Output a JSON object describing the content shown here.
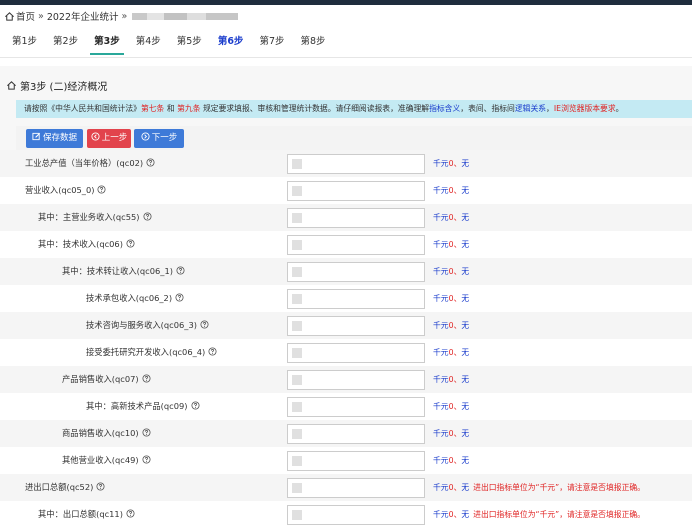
{
  "breadcrumb": {
    "home": "首页",
    "sep": "»",
    "year_item": "2022年企业统计"
  },
  "steps": [
    {
      "label": "第1步",
      "state": "normal"
    },
    {
      "label": "第2步",
      "state": "normal"
    },
    {
      "label": "第3步",
      "state": "active"
    },
    {
      "label": "第4步",
      "state": "normal"
    },
    {
      "label": "第5步",
      "state": "normal"
    },
    {
      "label": "第6步",
      "state": "blue"
    },
    {
      "label": "第7步",
      "state": "normal"
    },
    {
      "label": "第8步",
      "state": "normal"
    }
  ],
  "panel": {
    "title": "第3步 (二)经济概况"
  },
  "notice": {
    "p1": "请按照《中华人民共和国统计法》",
    "art7": "第七条",
    "and": " 和 ",
    "art9": "第九条",
    "p2": " 规定要求填报、审核和管理统计数据。请仔细阅读报表，准确理解",
    "indicator": "指标含义",
    "p3": "，表间、指标间",
    "logic": "逻辑关系",
    "p4": "，",
    "ie": "IE浏览器版本要求",
    "p5": "。"
  },
  "toolbar": {
    "save_label": "保存数据",
    "prev_label": "上一步",
    "next_label": "下一步"
  },
  "rows": [
    {
      "label": "工业总产值（当年价格）(qc02)",
      "unit": "千元",
      "value": "0",
      "sep": "、",
      "status": "无",
      "warning": ""
    },
    {
      "label": "营业收入(qc05_0)",
      "unit": "千元",
      "value": "0",
      "sep": "、",
      "status": "无",
      "warning": ""
    },
    {
      "label": "其中：主营业务收入(qc55)",
      "unit": "千元",
      "value": "0",
      "sep": "、",
      "status": "无",
      "warning": ""
    },
    {
      "label": "其中：技术收入(qc06)",
      "unit": "千元",
      "value": "0",
      "sep": "、",
      "status": "无",
      "warning": ""
    },
    {
      "label": "其中：技术转让收入(qc06_1)",
      "unit": "千元",
      "value": "0",
      "sep": "、",
      "status": "无",
      "warning": ""
    },
    {
      "label": "技术承包收入(qc06_2)",
      "unit": "千元",
      "value": "0",
      "sep": "、",
      "status": "无",
      "warning": ""
    },
    {
      "label": "技术咨询与服务收入(qc06_3)",
      "unit": "千元",
      "value": "0",
      "sep": "、",
      "status": "无",
      "warning": ""
    },
    {
      "label": "接受委托研究开发收入(qc06_4)",
      "unit": "千元",
      "value": "0",
      "sep": "、",
      "status": "无",
      "warning": ""
    },
    {
      "label": "产品销售收入(qc07)",
      "unit": "千元",
      "value": "0",
      "sep": "、",
      "status": "无",
      "warning": ""
    },
    {
      "label": "其中：高新技术产品(qc09)",
      "unit": "千元",
      "value": "0",
      "sep": "、",
      "status": "无",
      "warning": ""
    },
    {
      "label": "商品销售收入(qc10)",
      "unit": "千元",
      "value": "0",
      "sep": "、",
      "status": "无",
      "warning": ""
    },
    {
      "label": "其他营业收入(qc49)",
      "unit": "千元",
      "value": "0",
      "sep": "、",
      "status": "无",
      "warning": ""
    },
    {
      "label": "进出口总额(qc52)",
      "unit": "千元",
      "value": "0",
      "sep": "、",
      "status": "无",
      "warning": "进出口指标单位为“千元”，请注意是否填报正确。"
    },
    {
      "label": "其中：出口总额(qc11)",
      "unit": "千元",
      "value": "0",
      "sep": "、",
      "status": "无",
      "warning": "进出口指标单位为“千元”，请注意是否填报正确。"
    }
  ]
}
